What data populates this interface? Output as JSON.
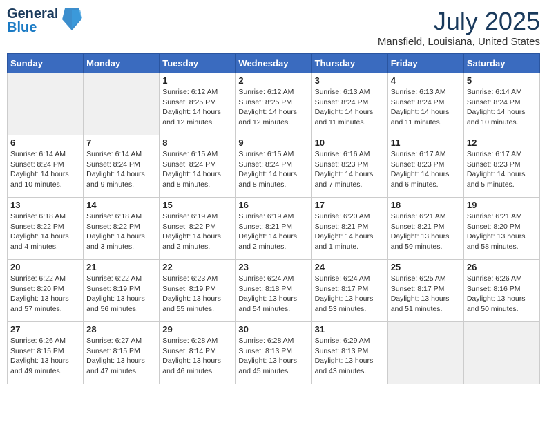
{
  "header": {
    "logo_line1": "General",
    "logo_line2": "Blue",
    "month": "July 2025",
    "location": "Mansfield, Louisiana, United States"
  },
  "days_of_week": [
    "Sunday",
    "Monday",
    "Tuesday",
    "Wednesday",
    "Thursday",
    "Friday",
    "Saturday"
  ],
  "weeks": [
    [
      {
        "num": "",
        "info": "",
        "empty": true
      },
      {
        "num": "",
        "info": "",
        "empty": true
      },
      {
        "num": "1",
        "info": "Sunrise: 6:12 AM\nSunset: 8:25 PM\nDaylight: 14 hours\nand 12 minutes."
      },
      {
        "num": "2",
        "info": "Sunrise: 6:12 AM\nSunset: 8:25 PM\nDaylight: 14 hours\nand 12 minutes."
      },
      {
        "num": "3",
        "info": "Sunrise: 6:13 AM\nSunset: 8:24 PM\nDaylight: 14 hours\nand 11 minutes."
      },
      {
        "num": "4",
        "info": "Sunrise: 6:13 AM\nSunset: 8:24 PM\nDaylight: 14 hours\nand 11 minutes."
      },
      {
        "num": "5",
        "info": "Sunrise: 6:14 AM\nSunset: 8:24 PM\nDaylight: 14 hours\nand 10 minutes."
      }
    ],
    [
      {
        "num": "6",
        "info": "Sunrise: 6:14 AM\nSunset: 8:24 PM\nDaylight: 14 hours\nand 10 minutes."
      },
      {
        "num": "7",
        "info": "Sunrise: 6:14 AM\nSunset: 8:24 PM\nDaylight: 14 hours\nand 9 minutes."
      },
      {
        "num": "8",
        "info": "Sunrise: 6:15 AM\nSunset: 8:24 PM\nDaylight: 14 hours\nand 8 minutes."
      },
      {
        "num": "9",
        "info": "Sunrise: 6:15 AM\nSunset: 8:24 PM\nDaylight: 14 hours\nand 8 minutes."
      },
      {
        "num": "10",
        "info": "Sunrise: 6:16 AM\nSunset: 8:23 PM\nDaylight: 14 hours\nand 7 minutes."
      },
      {
        "num": "11",
        "info": "Sunrise: 6:17 AM\nSunset: 8:23 PM\nDaylight: 14 hours\nand 6 minutes."
      },
      {
        "num": "12",
        "info": "Sunrise: 6:17 AM\nSunset: 8:23 PM\nDaylight: 14 hours\nand 5 minutes."
      }
    ],
    [
      {
        "num": "13",
        "info": "Sunrise: 6:18 AM\nSunset: 8:22 PM\nDaylight: 14 hours\nand 4 minutes."
      },
      {
        "num": "14",
        "info": "Sunrise: 6:18 AM\nSunset: 8:22 PM\nDaylight: 14 hours\nand 3 minutes."
      },
      {
        "num": "15",
        "info": "Sunrise: 6:19 AM\nSunset: 8:22 PM\nDaylight: 14 hours\nand 2 minutes."
      },
      {
        "num": "16",
        "info": "Sunrise: 6:19 AM\nSunset: 8:21 PM\nDaylight: 14 hours\nand 2 minutes."
      },
      {
        "num": "17",
        "info": "Sunrise: 6:20 AM\nSunset: 8:21 PM\nDaylight: 14 hours\nand 1 minute."
      },
      {
        "num": "18",
        "info": "Sunrise: 6:21 AM\nSunset: 8:21 PM\nDaylight: 13 hours\nand 59 minutes."
      },
      {
        "num": "19",
        "info": "Sunrise: 6:21 AM\nSunset: 8:20 PM\nDaylight: 13 hours\nand 58 minutes."
      }
    ],
    [
      {
        "num": "20",
        "info": "Sunrise: 6:22 AM\nSunset: 8:20 PM\nDaylight: 13 hours\nand 57 minutes."
      },
      {
        "num": "21",
        "info": "Sunrise: 6:22 AM\nSunset: 8:19 PM\nDaylight: 13 hours\nand 56 minutes."
      },
      {
        "num": "22",
        "info": "Sunrise: 6:23 AM\nSunset: 8:19 PM\nDaylight: 13 hours\nand 55 minutes."
      },
      {
        "num": "23",
        "info": "Sunrise: 6:24 AM\nSunset: 8:18 PM\nDaylight: 13 hours\nand 54 minutes."
      },
      {
        "num": "24",
        "info": "Sunrise: 6:24 AM\nSunset: 8:17 PM\nDaylight: 13 hours\nand 53 minutes."
      },
      {
        "num": "25",
        "info": "Sunrise: 6:25 AM\nSunset: 8:17 PM\nDaylight: 13 hours\nand 51 minutes."
      },
      {
        "num": "26",
        "info": "Sunrise: 6:26 AM\nSunset: 8:16 PM\nDaylight: 13 hours\nand 50 minutes."
      }
    ],
    [
      {
        "num": "27",
        "info": "Sunrise: 6:26 AM\nSunset: 8:15 PM\nDaylight: 13 hours\nand 49 minutes."
      },
      {
        "num": "28",
        "info": "Sunrise: 6:27 AM\nSunset: 8:15 PM\nDaylight: 13 hours\nand 47 minutes."
      },
      {
        "num": "29",
        "info": "Sunrise: 6:28 AM\nSunset: 8:14 PM\nDaylight: 13 hours\nand 46 minutes."
      },
      {
        "num": "30",
        "info": "Sunrise: 6:28 AM\nSunset: 8:13 PM\nDaylight: 13 hours\nand 45 minutes."
      },
      {
        "num": "31",
        "info": "Sunrise: 6:29 AM\nSunset: 8:13 PM\nDaylight: 13 hours\nand 43 minutes."
      },
      {
        "num": "",
        "info": "",
        "empty": true
      },
      {
        "num": "",
        "info": "",
        "empty": true
      }
    ]
  ]
}
